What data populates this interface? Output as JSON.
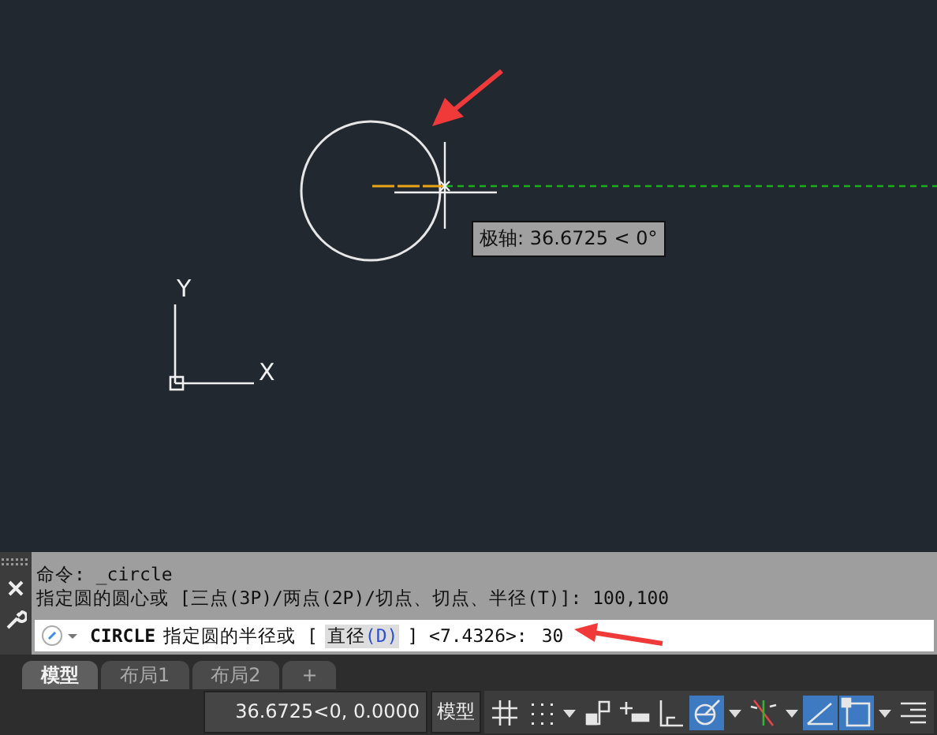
{
  "drawing": {
    "tooltip": {
      "label": "极轴: 36.6725 < 0°"
    },
    "ucs": {
      "x_label": "X",
      "y_label": "Y"
    }
  },
  "command_history": [
    "命令: _circle",
    "指定圆的圆心或 [三点(3P)/两点(2P)/切点、切点、半径(T)]: 100,100"
  ],
  "command_line": {
    "command": "CIRCLE",
    "prompt": "指定圆的半径或 [",
    "option": "直径",
    "option_key": "(D)",
    "rest": "] <7.4326>:",
    "input": "30"
  },
  "layout_tabs": [
    {
      "label": "模型",
      "selected": true
    },
    {
      "label": "布局1",
      "selected": false
    },
    {
      "label": "布局2",
      "selected": false
    },
    {
      "label": "+",
      "selected": false
    }
  ],
  "status_bar": {
    "coordinates": "36.6725<0, 0.0000",
    "space": "模型",
    "toggles": [
      {
        "kind": "button",
        "on": false
      },
      {
        "kind": "button",
        "on": false
      },
      {
        "kind": "dropdown",
        "on": false
      },
      {
        "kind": "button",
        "on": false
      },
      {
        "kind": "button",
        "on": false
      },
      {
        "kind": "button",
        "on": false
      },
      {
        "kind": "button",
        "on": true
      },
      {
        "kind": "dropdown",
        "on": false
      },
      {
        "kind": "button",
        "on": false
      },
      {
        "kind": "dropdown",
        "on": false
      },
      {
        "kind": "button",
        "on": true
      },
      {
        "kind": "button",
        "on": true
      },
      {
        "kind": "dropdown",
        "on": false
      },
      {
        "kind": "button",
        "on": false
      }
    ]
  }
}
